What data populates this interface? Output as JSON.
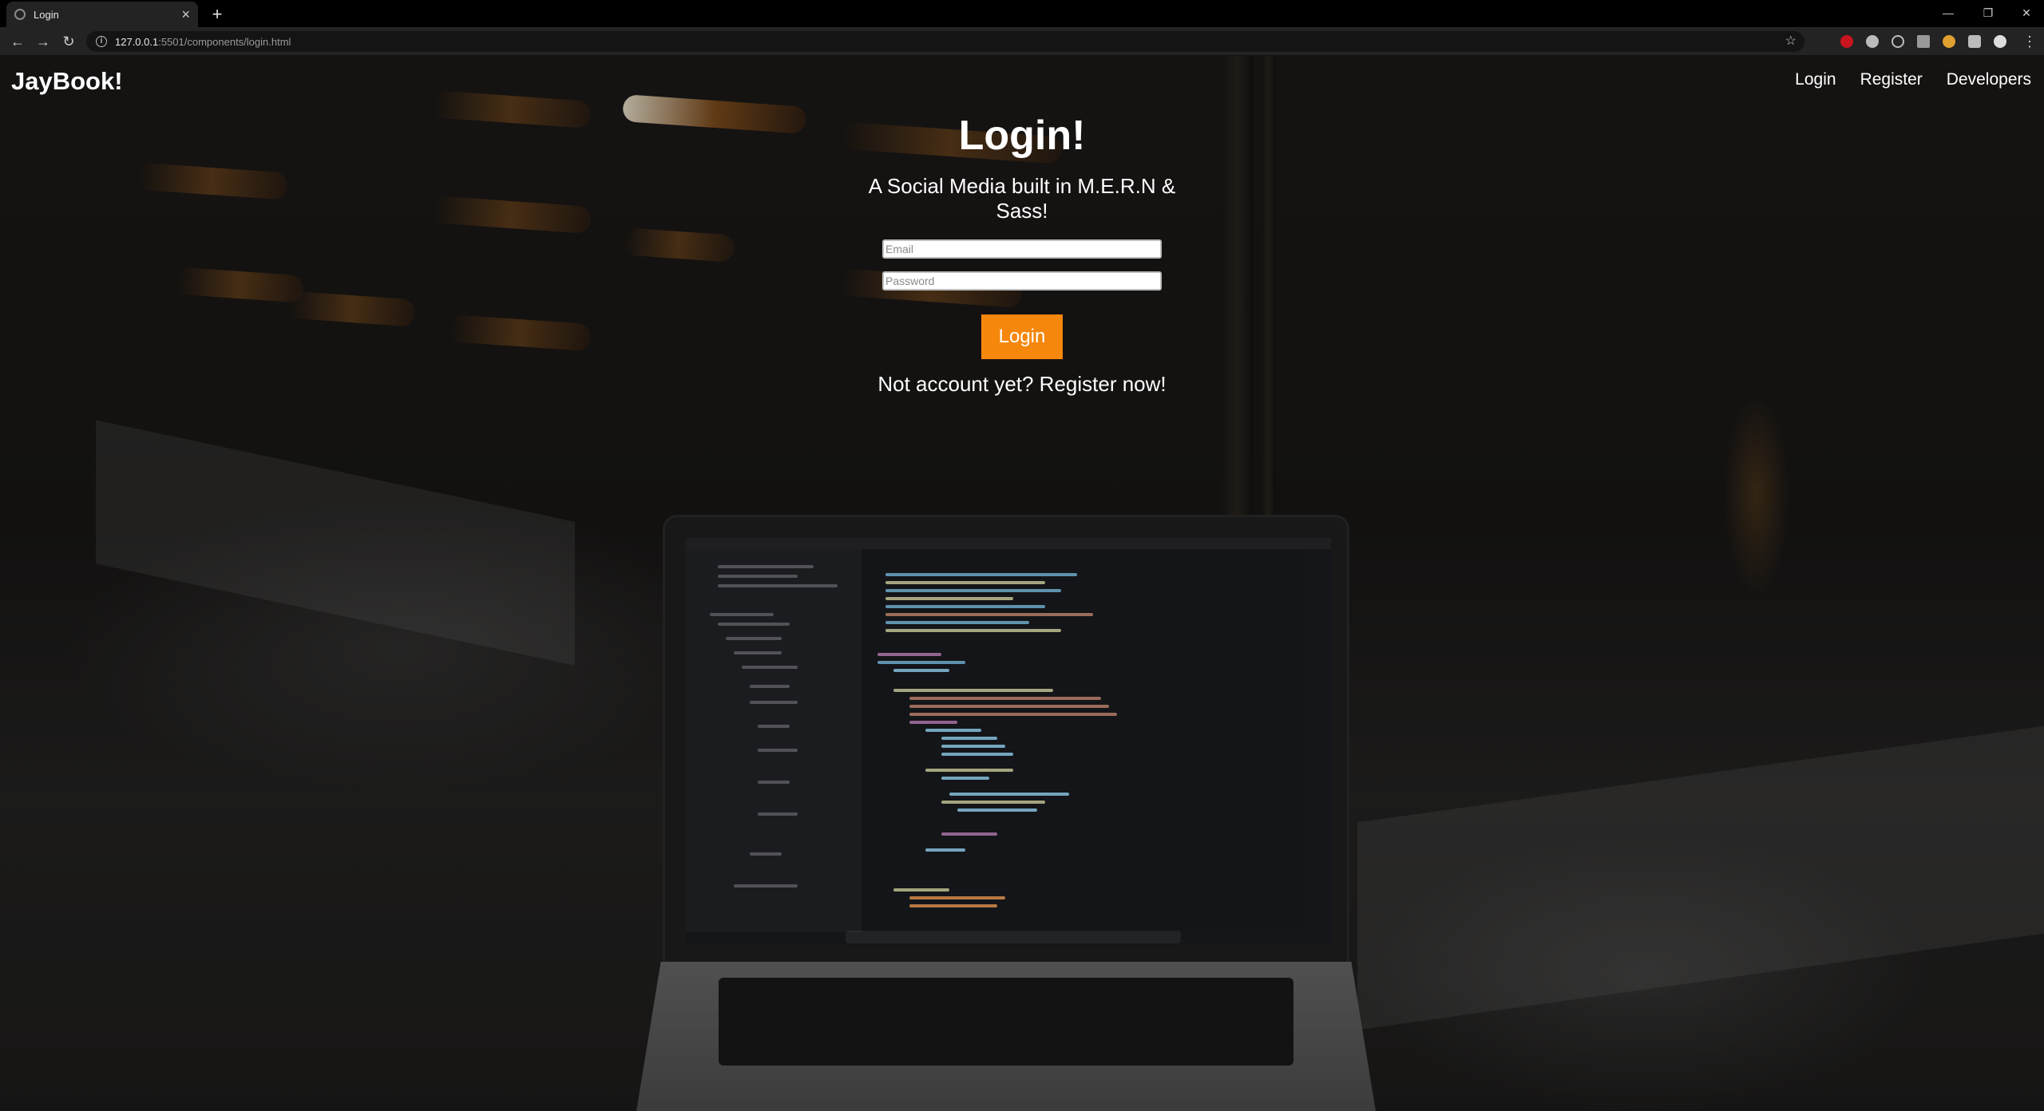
{
  "browser": {
    "tab_title": "Login",
    "new_tab": "+",
    "close_tab": "×",
    "url_host": "127.0.0.1",
    "url_path": ":5501/components/login.html"
  },
  "site": {
    "brand": "JayBook!",
    "nav": [
      {
        "label": "Login"
      },
      {
        "label": "Register"
      },
      {
        "label": "Developers"
      }
    ]
  },
  "login": {
    "title": "Login!",
    "subtitle": "A Social Media built in M.E.R.N & Sass!",
    "email_placeholder": "Email",
    "password_placeholder": "Password",
    "button_label": "Login",
    "register_prompt": "Not account yet? Register now!",
    "button_color": "#f5870c"
  }
}
